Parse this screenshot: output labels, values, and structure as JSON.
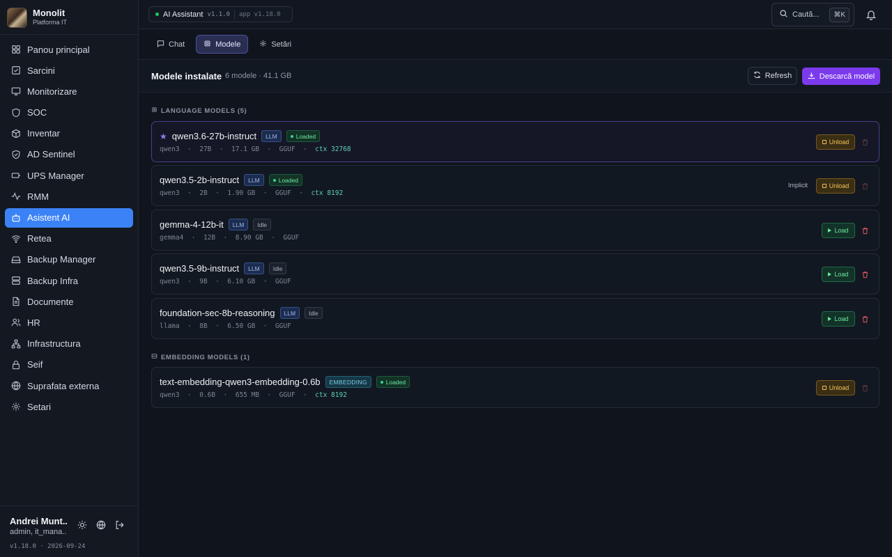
{
  "brand": {
    "name": "Monolit",
    "subtitle": "Platforma IT"
  },
  "sidebar": {
    "items": [
      {
        "label": "Panou principal",
        "icon": "dashboard-icon"
      },
      {
        "label": "Sarcini",
        "icon": "tasks-icon"
      },
      {
        "label": "Monitorizare",
        "icon": "monitor-icon"
      },
      {
        "label": "SOC",
        "icon": "shield-icon"
      },
      {
        "label": "Inventar",
        "icon": "box-icon"
      },
      {
        "label": "AD Sentinel",
        "icon": "shield-check-icon"
      },
      {
        "label": "UPS Manager",
        "icon": "battery-icon"
      },
      {
        "label": "RMM",
        "icon": "activity-icon"
      },
      {
        "label": "Asistent AI",
        "icon": "bot-icon",
        "active": true
      },
      {
        "label": "Retea",
        "icon": "wifi-icon"
      },
      {
        "label": "Backup Manager",
        "icon": "hard-drive-icon"
      },
      {
        "label": "Backup Infra",
        "icon": "database-icon"
      },
      {
        "label": "Documente",
        "icon": "document-icon"
      },
      {
        "label": "HR",
        "icon": "users-icon"
      },
      {
        "label": "Infrastructura",
        "icon": "network-icon"
      },
      {
        "label": "Seif",
        "icon": "lock-icon"
      },
      {
        "label": "Suprafata externa",
        "icon": "globe-icon"
      },
      {
        "label": "Setari",
        "icon": "gear-icon"
      }
    ]
  },
  "user": {
    "name": "Andrei Munt...",
    "role": "admin, it_mana...",
    "version": "v1.18.0 · 2026-09-24"
  },
  "topbar": {
    "assistant_label": "AI Assistant",
    "assistant_version": "v1.1.0",
    "app_version": "app v1.18.0",
    "search_placeholder": "Caută...",
    "search_shortcut": "⌘K"
  },
  "tabs": [
    {
      "label": "Chat",
      "icon": "chat-icon"
    },
    {
      "label": "Modele",
      "icon": "cpu-icon",
      "active": true
    },
    {
      "label": "Setări",
      "icon": "gear-icon"
    }
  ],
  "header": {
    "title": "Modele instalate",
    "stats": "6 modele · 41.1 GB",
    "refresh_label": "Refresh",
    "download_label": "Descarcă model"
  },
  "sections": {
    "language": "LANGUAGE MODELS (5)",
    "embedding": "EMBEDDING MODELS (1)"
  },
  "models": [
    {
      "name": "qwen3.6-27b-instruct",
      "type": "LLM",
      "status": "Loaded",
      "starred": true,
      "family": "qwen3",
      "params": "27B",
      "size": "17.1 GB",
      "format": "GGUF",
      "ctx": "ctx 32768",
      "action": "Unload"
    },
    {
      "name": "qwen3.5-2b-instruct",
      "type": "LLM",
      "status": "Loaded",
      "family": "qwen3",
      "params": "2B",
      "size": "1.90 GB",
      "format": "GGUF",
      "ctx": "ctx 8192",
      "action": "Unload",
      "tag": "Implicit"
    },
    {
      "name": "gemma-4-12b-it",
      "type": "LLM",
      "status": "Idle",
      "family": "gemma4",
      "params": "12B",
      "size": "8.90 GB",
      "format": "GGUF",
      "action": "Load"
    },
    {
      "name": "qwen3.5-9b-instruct",
      "type": "LLM",
      "status": "Idle",
      "family": "qwen3",
      "params": "9B",
      "size": "6.10 GB",
      "format": "GGUF",
      "action": "Load"
    },
    {
      "name": "foundation-sec-8b-reasoning",
      "type": "LLM",
      "status": "Idle",
      "family": "llama",
      "params": "8B",
      "size": "6.50 GB",
      "format": "GGUF",
      "action": "Load"
    },
    {
      "name": "text-embedding-qwen3-embedding-0.6b",
      "type": "EMBEDDING",
      "status": "Loaded",
      "family": "qwen3",
      "params": "0.6B",
      "size": "655 MB",
      "format": "GGUF",
      "ctx": "ctx 8192",
      "action": "Unload"
    }
  ],
  "colors": {
    "accent": "#3b82f6",
    "primary_button": "#7c3aed",
    "loaded": "#22c55e",
    "unload": "#f3c45a",
    "danger": "#e25563"
  }
}
